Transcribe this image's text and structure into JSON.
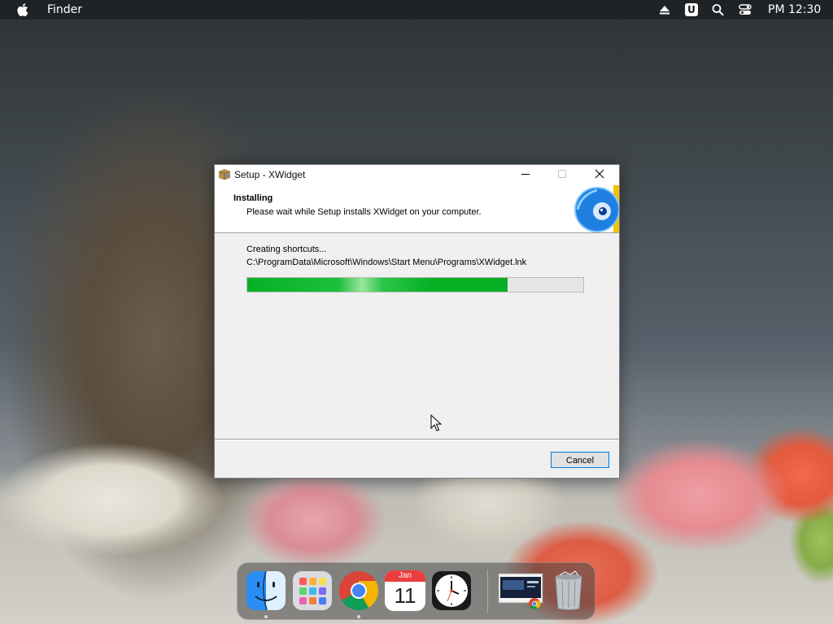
{
  "menubar": {
    "app_name": "Finder",
    "clock": "PM 12:30",
    "icons": [
      "apple-logo-icon",
      "eject-icon",
      "u-badge-icon",
      "search-icon",
      "control-center-icon"
    ],
    "u_badge_text": "U"
  },
  "window": {
    "title": "Setup - XWidget",
    "header_title": "Installing",
    "header_subtitle": "Please wait while Setup installs XWidget on your computer.",
    "status_text": "Creating shortcuts...",
    "file_path": "C:\\ProgramData\\Microsoft\\Windows\\Start Menu\\Programs\\XWidget.lnk",
    "progress_fraction": 0.775,
    "cancel_label": "Cancel",
    "colors": {
      "progress": "#06b025",
      "focus_border": "#0078d7"
    }
  },
  "dock": {
    "items": [
      "finder-icon",
      "launchpad-icon",
      "chrome-icon",
      "calendar-icon",
      "clock-icon",
      "window-thumbnail",
      "trash-icon"
    ],
    "calendar_month": "Jan",
    "calendar_day": "11"
  }
}
